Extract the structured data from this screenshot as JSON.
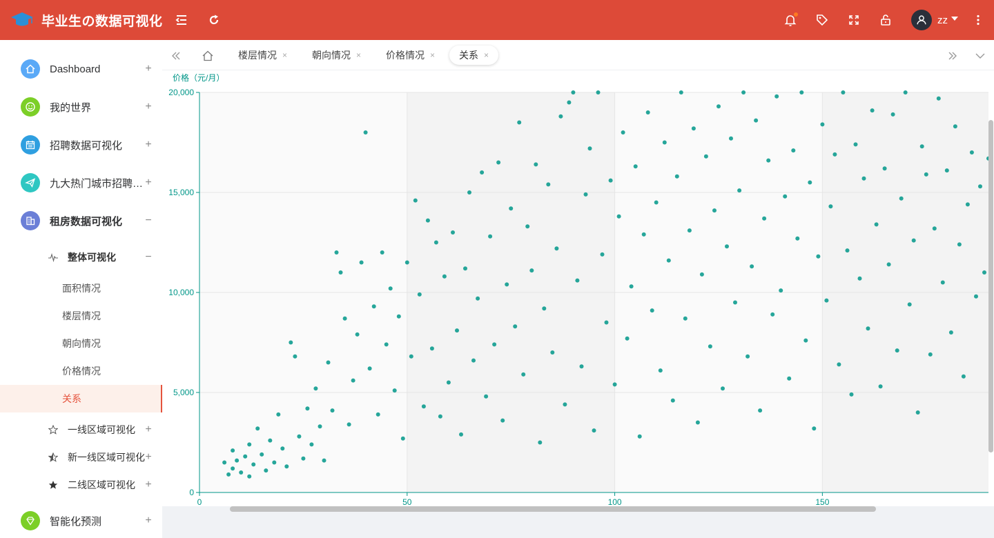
{
  "app": {
    "title": "毕业生の数据可视化",
    "user_name": "zz",
    "accent_color": "#dd4a38",
    "active_color": "#e5533d"
  },
  "topbar": {
    "icons": [
      "menu-fold-icon",
      "refresh-icon",
      "bell-icon",
      "tag-icon",
      "fullscreen-icon",
      "lock-icon",
      "user-avatar-icon",
      "caret-down-icon",
      "more-vertical-icon"
    ]
  },
  "sidebar": {
    "items": [
      {
        "label": "Dashboard",
        "icon": "home-icon",
        "color": "#5aa9f7",
        "toggle": "+"
      },
      {
        "label": "我的世界",
        "icon": "smile-icon",
        "color": "#7ccf27",
        "toggle": "+"
      },
      {
        "label": "招聘数据可视化",
        "icon": "calendar-icon",
        "color": "#2f9fe0",
        "toggle": "+"
      },
      {
        "label": "九大热门城市招聘…",
        "icon": "send-icon",
        "color": "#2fc7c2",
        "toggle": "+"
      },
      {
        "label": "租房数据可视化",
        "icon": "building-icon",
        "color": "#6b7fd7",
        "toggle": "−"
      }
    ],
    "group": {
      "label": "整体可视化",
      "icon": "pulse-icon",
      "toggle": "−"
    },
    "sub_items": [
      "面积情况",
      "楼层情况",
      "朝向情况",
      "价格情况",
      "关系"
    ],
    "active_sub": "关系",
    "region_items": [
      {
        "label": "一线区域可视化",
        "icon": "star-outline-icon",
        "toggle": "+"
      },
      {
        "label": "新一线区域可视化",
        "icon": "star-half-icon",
        "toggle": "+"
      },
      {
        "label": "二线区域可视化",
        "icon": "star-filled-icon",
        "toggle": "+"
      }
    ],
    "last_item": {
      "label": "智能化预测",
      "icon": "diamond-icon",
      "color": "#7ccf27",
      "toggle": "+"
    }
  },
  "tabs": {
    "items": [
      {
        "label": "楼层情况",
        "close": "×"
      },
      {
        "label": "朝向情况",
        "close": "×"
      },
      {
        "label": "价格情况",
        "close": "×"
      },
      {
        "label": "关系",
        "close": "×"
      }
    ],
    "active": "关系"
  },
  "chart_data": {
    "type": "scatter",
    "title": "",
    "xlabel": "",
    "ylabel": "价格（元/月）",
    "xlim": [
      0,
      190
    ],
    "ylim": [
      0,
      20000
    ],
    "x_ticks": [
      "0",
      "50",
      "100",
      "150"
    ],
    "y_ticks": [
      "0",
      "5,000",
      "10,000",
      "15,000",
      "20,000"
    ],
    "grid": true,
    "point_color": "#009688",
    "series": [
      {
        "points": [
          [
            6,
            1500
          ],
          [
            7,
            900
          ],
          [
            8,
            1200
          ],
          [
            8,
            2100
          ],
          [
            9,
            1600
          ],
          [
            10,
            1000
          ],
          [
            11,
            1800
          ],
          [
            12,
            2400
          ],
          [
            12,
            800
          ],
          [
            13,
            1400
          ],
          [
            14,
            3200
          ],
          [
            15,
            1900
          ],
          [
            16,
            1100
          ],
          [
            17,
            2600
          ],
          [
            18,
            1500
          ],
          [
            19,
            3900
          ],
          [
            20,
            2200
          ],
          [
            21,
            1300
          ],
          [
            22,
            7500
          ],
          [
            23,
            6800
          ],
          [
            24,
            2800
          ],
          [
            25,
            1700
          ],
          [
            26,
            4200
          ],
          [
            27,
            2400
          ],
          [
            28,
            5200
          ],
          [
            29,
            3300
          ],
          [
            30,
            1600
          ],
          [
            31,
            6500
          ],
          [
            32,
            4100
          ],
          [
            33,
            12000
          ],
          [
            34,
            11000
          ],
          [
            35,
            8700
          ],
          [
            36,
            3400
          ],
          [
            37,
            5600
          ],
          [
            38,
            7900
          ],
          [
            39,
            11500
          ],
          [
            40,
            18000
          ],
          [
            41,
            6200
          ],
          [
            42,
            9300
          ],
          [
            43,
            3900
          ],
          [
            44,
            12000
          ],
          [
            45,
            7400
          ],
          [
            46,
            10200
          ],
          [
            47,
            5100
          ],
          [
            48,
            8800
          ],
          [
            49,
            2700
          ],
          [
            50,
            11500
          ],
          [
            51,
            6800
          ],
          [
            52,
            14600
          ],
          [
            53,
            9900
          ],
          [
            54,
            4300
          ],
          [
            55,
            13600
          ],
          [
            56,
            7200
          ],
          [
            57,
            12500
          ],
          [
            58,
            3800
          ],
          [
            59,
            10800
          ],
          [
            60,
            5500
          ],
          [
            61,
            13000
          ],
          [
            62,
            8100
          ],
          [
            63,
            2900
          ],
          [
            64,
            11200
          ],
          [
            65,
            15000
          ],
          [
            66,
            6600
          ],
          [
            67,
            9700
          ],
          [
            68,
            16000
          ],
          [
            69,
            4800
          ],
          [
            70,
            12800
          ],
          [
            71,
            7400
          ],
          [
            72,
            16500
          ],
          [
            73,
            3600
          ],
          [
            74,
            10400
          ],
          [
            75,
            14200
          ],
          [
            76,
            8300
          ],
          [
            77,
            18500
          ],
          [
            78,
            5900
          ],
          [
            79,
            13300
          ],
          [
            80,
            11100
          ],
          [
            81,
            16400
          ],
          [
            82,
            2500
          ],
          [
            83,
            9200
          ],
          [
            84,
            15400
          ],
          [
            85,
            7000
          ],
          [
            86,
            12200
          ],
          [
            87,
            18800
          ],
          [
            88,
            4400
          ],
          [
            89,
            19500
          ],
          [
            90,
            20000
          ],
          [
            91,
            10600
          ],
          [
            92,
            6300
          ],
          [
            93,
            14900
          ],
          [
            94,
            17200
          ],
          [
            95,
            3100
          ],
          [
            96,
            20000
          ],
          [
            97,
            11900
          ],
          [
            98,
            8500
          ],
          [
            99,
            15600
          ],
          [
            100,
            5400
          ],
          [
            101,
            13800
          ],
          [
            102,
            18000
          ],
          [
            103,
            7700
          ],
          [
            104,
            10300
          ],
          [
            105,
            16300
          ],
          [
            106,
            2800
          ],
          [
            107,
            12900
          ],
          [
            108,
            19000
          ],
          [
            109,
            9100
          ],
          [
            110,
            14500
          ],
          [
            111,
            6100
          ],
          [
            112,
            17500
          ],
          [
            113,
            11600
          ],
          [
            114,
            4600
          ],
          [
            115,
            15800
          ],
          [
            116,
            20000
          ],
          [
            117,
            8700
          ],
          [
            118,
            13100
          ],
          [
            119,
            18200
          ],
          [
            120,
            3500
          ],
          [
            121,
            10900
          ],
          [
            122,
            16800
          ],
          [
            123,
            7300
          ],
          [
            124,
            14100
          ],
          [
            125,
            19300
          ],
          [
            126,
            5200
          ],
          [
            127,
            12300
          ],
          [
            128,
            17700
          ],
          [
            129,
            9500
          ],
          [
            130,
            15100
          ],
          [
            131,
            20000
          ],
          [
            132,
            6800
          ],
          [
            133,
            11300
          ],
          [
            134,
            18600
          ],
          [
            135,
            4100
          ],
          [
            136,
            13700
          ],
          [
            137,
            16600
          ],
          [
            138,
            8900
          ],
          [
            139,
            19800
          ],
          [
            140,
            10100
          ],
          [
            141,
            14800
          ],
          [
            142,
            5700
          ],
          [
            143,
            17100
          ],
          [
            144,
            12700
          ],
          [
            145,
            20000
          ],
          [
            146,
            7600
          ],
          [
            147,
            15500
          ],
          [
            148,
            3200
          ],
          [
            149,
            11800
          ],
          [
            150,
            18400
          ],
          [
            151,
            9600
          ],
          [
            152,
            14300
          ],
          [
            153,
            16900
          ],
          [
            154,
            6400
          ],
          [
            155,
            20000
          ],
          [
            156,
            12100
          ],
          [
            157,
            4900
          ],
          [
            158,
            17400
          ],
          [
            159,
            10700
          ],
          [
            160,
            15700
          ],
          [
            161,
            8200
          ],
          [
            162,
            19100
          ],
          [
            163,
            13400
          ],
          [
            164,
            5300
          ],
          [
            165,
            16200
          ],
          [
            166,
            11400
          ],
          [
            167,
            18900
          ],
          [
            168,
            7100
          ],
          [
            169,
            14700
          ],
          [
            170,
            20000
          ],
          [
            171,
            9400
          ],
          [
            172,
            12600
          ],
          [
            173,
            4000
          ],
          [
            174,
            17300
          ],
          [
            175,
            15900
          ],
          [
            176,
            6900
          ],
          [
            177,
            13200
          ],
          [
            178,
            19700
          ],
          [
            179,
            10500
          ],
          [
            180,
            16100
          ],
          [
            181,
            8000
          ],
          [
            182,
            18300
          ],
          [
            183,
            12400
          ],
          [
            184,
            5800
          ],
          [
            185,
            14400
          ],
          [
            186,
            17000
          ],
          [
            187,
            9800
          ],
          [
            188,
            15300
          ],
          [
            189,
            11000
          ],
          [
            190,
            16700
          ]
        ]
      }
    ]
  }
}
